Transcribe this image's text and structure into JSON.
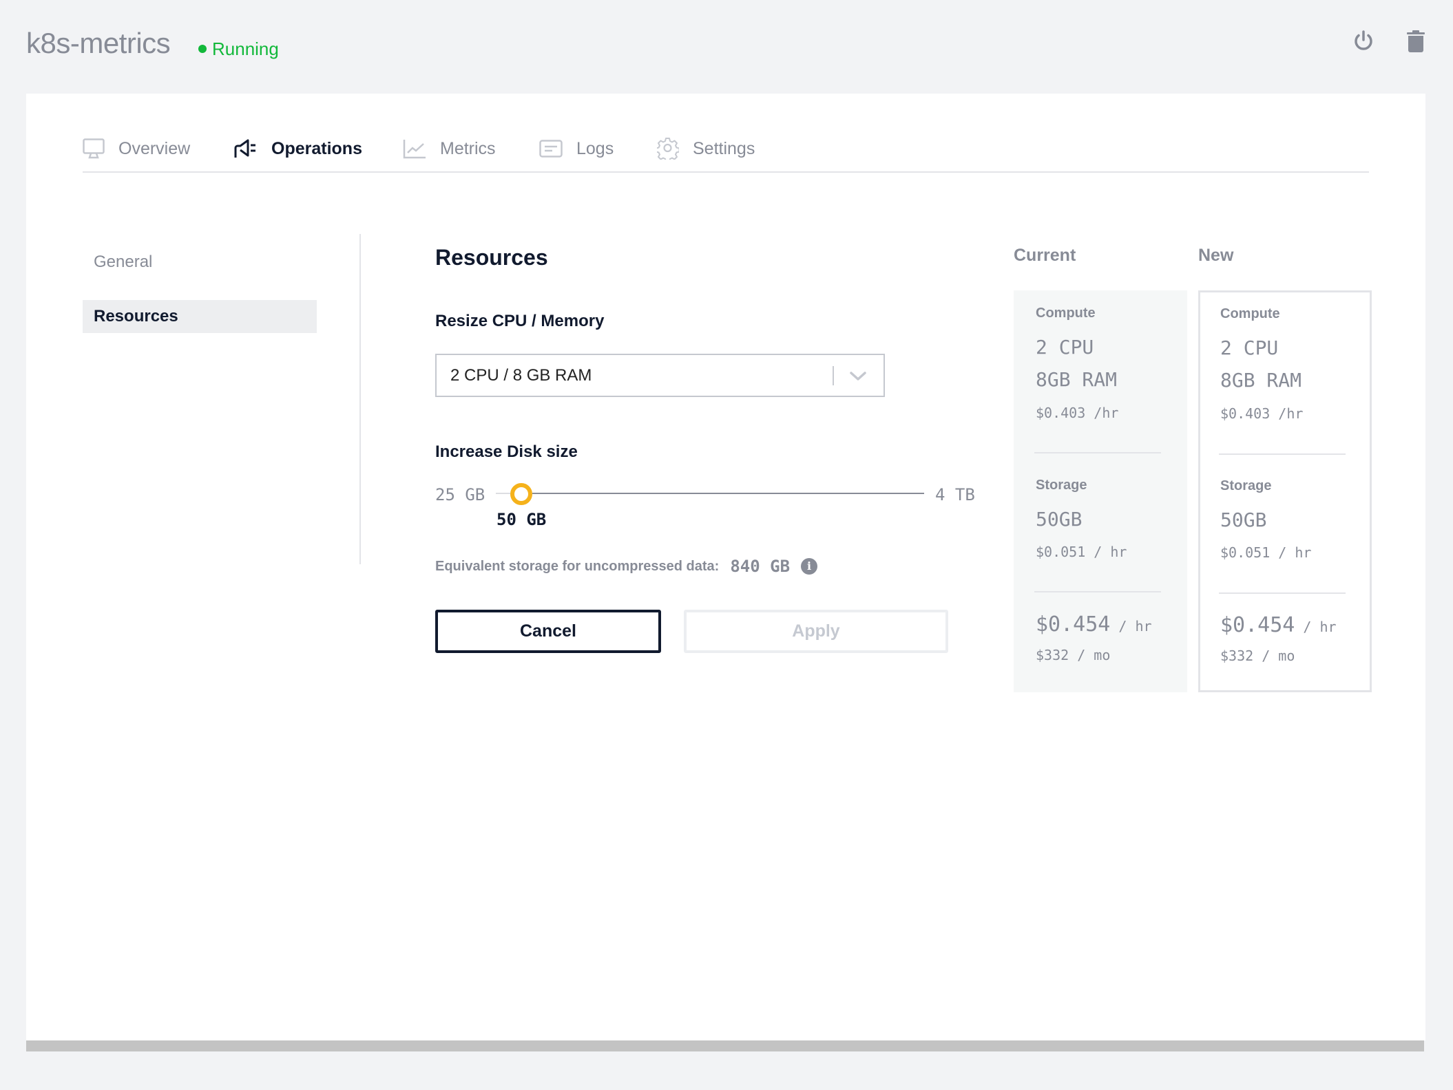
{
  "header": {
    "app_name": "k8s-metrics",
    "status": "Running",
    "status_color": "#12b83a",
    "actions": [
      {
        "name": "power",
        "icon": "power-icon"
      },
      {
        "name": "delete",
        "icon": "trash-icon"
      }
    ]
  },
  "tabs": [
    {
      "label": "Overview",
      "icon": "monitor-icon",
      "active": false
    },
    {
      "label": "Operations",
      "icon": "megaphone-icon",
      "active": true
    },
    {
      "label": "Metrics",
      "icon": "line-chart-icon",
      "active": false
    },
    {
      "label": "Logs",
      "icon": "log-list-icon",
      "active": false
    },
    {
      "label": "Settings",
      "icon": "gear-icon",
      "active": false
    }
  ],
  "sidebar": {
    "items": [
      {
        "label": "General",
        "active": false
      },
      {
        "label": "Resources",
        "active": true
      }
    ]
  },
  "resources": {
    "title": "Resources",
    "resize_label": "Resize CPU / Memory",
    "resize_value": "2 CPU / 8 GB RAM",
    "disk_label": "Increase Disk size",
    "disk_min": "25 GB",
    "disk_max": "4 TB",
    "disk_value": "50 GB",
    "disk_slider_position_percent": 6,
    "slider_color": "#f5b21b",
    "equiv_label": "Equivalent storage for uncompressed data:",
    "equiv_value": "840 GB",
    "info_glyph": "i",
    "cancel_label": "Cancel",
    "apply_label": "Apply",
    "apply_disabled": true
  },
  "comparison": {
    "current": {
      "heading": "Current",
      "compute_label": "Compute",
      "cpu": "2 CPU",
      "ram": "8GB RAM",
      "compute_price": "$0.403 /hr",
      "storage_label": "Storage",
      "storage": "50GB",
      "storage_price": "$0.051 / hr",
      "total_hourly": "$0.454",
      "total_hourly_unit": " / hr",
      "total_monthly": "$332 / mo"
    },
    "new": {
      "heading": "New",
      "compute_label": "Compute",
      "cpu": "2 CPU",
      "ram": "8GB RAM",
      "compute_price": "$0.403 /hr",
      "storage_label": "Storage",
      "storage": "50GB",
      "storage_price": "$0.051 / hr",
      "total_hourly": "$0.454",
      "total_hourly_unit": " / hr",
      "total_monthly": "$332 / mo"
    }
  }
}
